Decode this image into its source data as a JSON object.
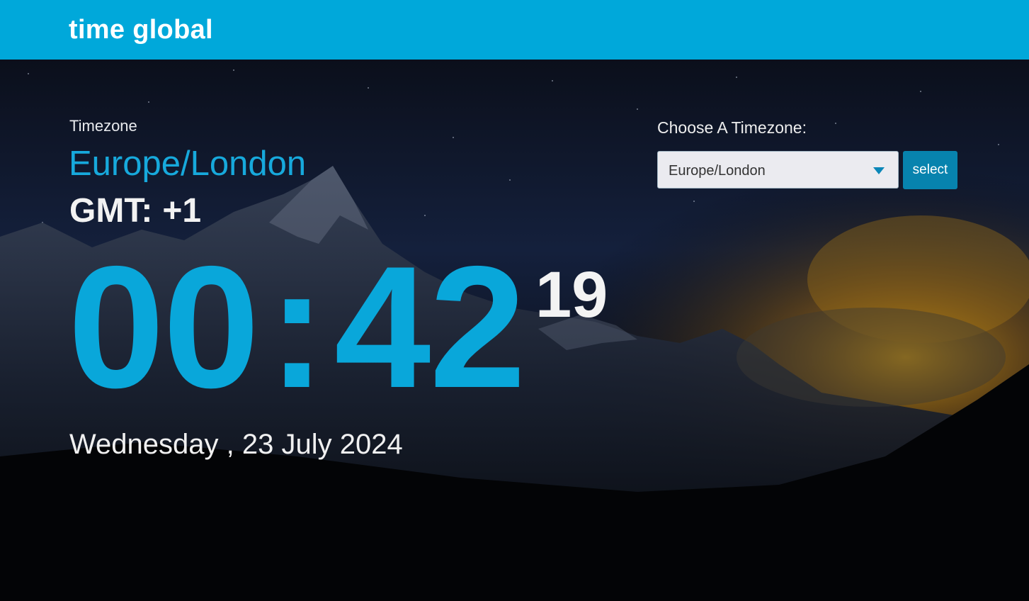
{
  "app": {
    "brand": "time global",
    "brand_color": "#00a8da"
  },
  "timezone_panel": {
    "caption": "Timezone",
    "name": "Europe/London",
    "gmt_label": "GMT:",
    "gmt_offset": "+1"
  },
  "clock": {
    "hours": "00",
    "separator": ":",
    "minutes": "42",
    "seconds": "19",
    "accent_color": "#09a7da"
  },
  "date": {
    "text": "Wednesday , 23 July 2024"
  },
  "picker": {
    "label": "Choose A Timezone:",
    "selected": "Europe/London",
    "button_label": "select",
    "button_color": "#0783ae"
  },
  "background": {
    "description_icon": "mountain-night-sky-image"
  }
}
